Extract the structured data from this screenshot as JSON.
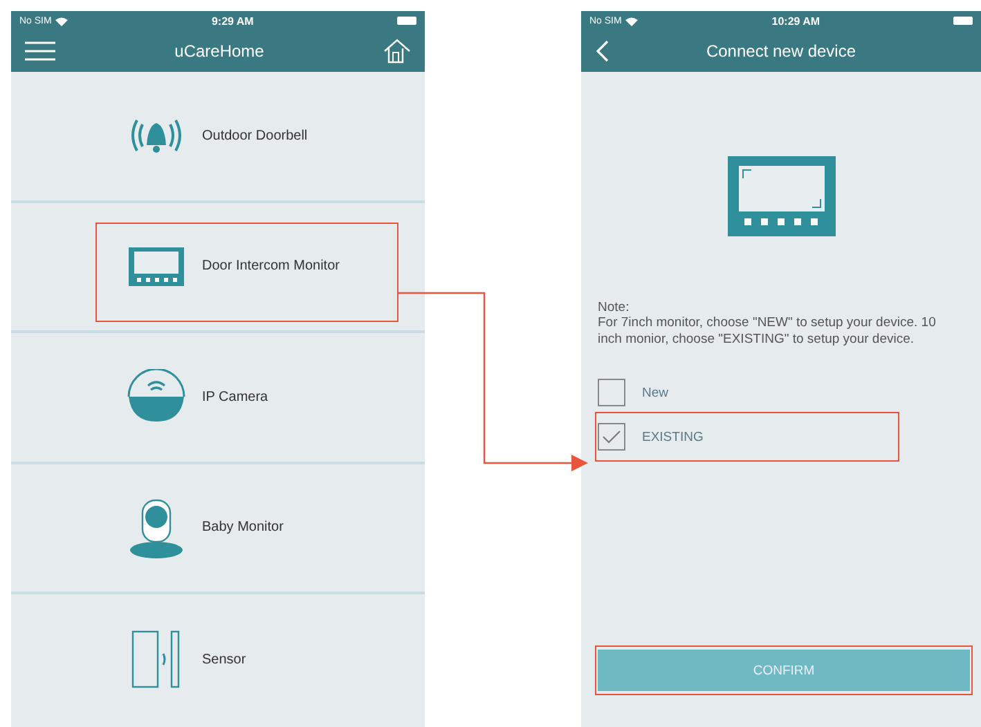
{
  "home_screen": {
    "status_bar": {
      "carrier": "No SIM",
      "time": "9:29 AM"
    },
    "title": "uCareHome",
    "devices": [
      {
        "kind": "doorbell",
        "label": "Outdoor Doorbell",
        "highlighted": false
      },
      {
        "kind": "monitor",
        "label": "Door Intercom Monitor",
        "highlighted": true
      },
      {
        "kind": "camera",
        "label": "IP Camera",
        "highlighted": false
      },
      {
        "kind": "baby",
        "label": "Baby Monitor",
        "highlighted": false
      },
      {
        "kind": "sensor",
        "label": "Sensor",
        "highlighted": false
      }
    ]
  },
  "connect_screen": {
    "status_bar": {
      "carrier": "No SIM",
      "time": "10:29 AM"
    },
    "title": "Connect new device",
    "note_heading": "Note:",
    "note": "For 7inch monitor, choose \"NEW\" to setup your device. 10 inch monior, choose \"EXISTING\" to setup your device.",
    "options": [
      {
        "label": "New",
        "checked": false,
        "highlighted": false
      },
      {
        "label": "EXISTING",
        "checked": true,
        "highlighted": true
      }
    ],
    "confirm_button": {
      "label": "CONFIRM",
      "highlighted": true
    }
  }
}
